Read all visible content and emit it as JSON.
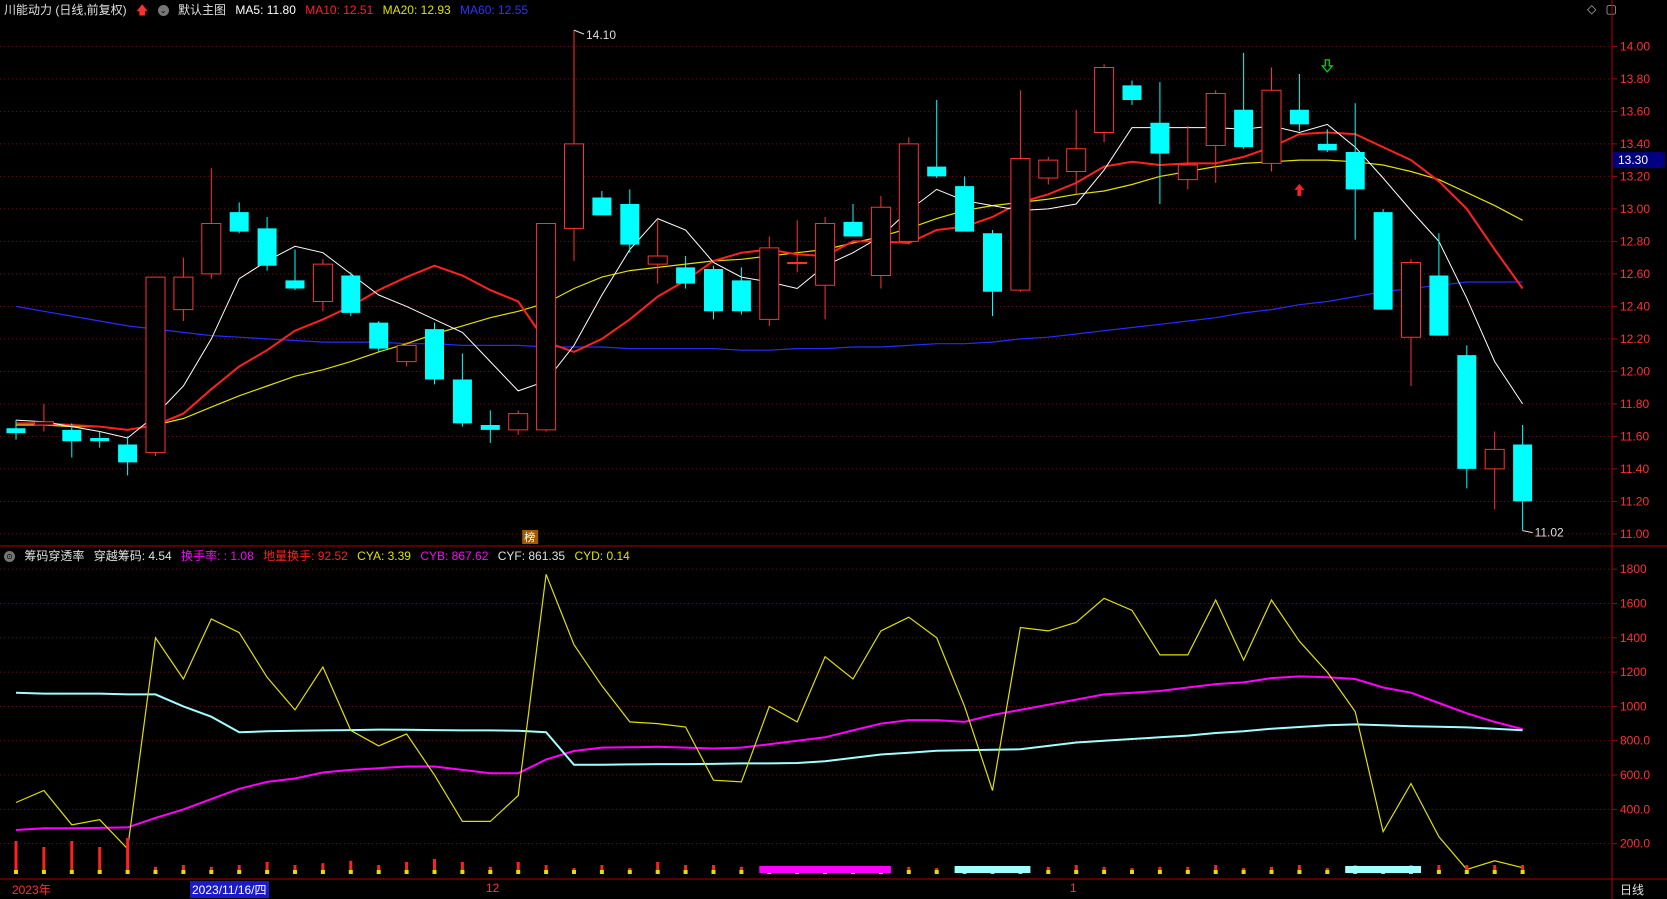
{
  "header": {
    "stock_name": "川能动力 (日线,前复权)",
    "main_view": "默认主图",
    "ma5": "MA5: 11.80",
    "ma10": "MA10: 12.51",
    "ma20": "MA20: 12.93",
    "ma60": "MA60: 12.55"
  },
  "sub_header": {
    "title": "筹码穿透率",
    "cross": "穿越筹码: 4.54",
    "turnover": "换手率: : 1.08",
    "ground": "地量换手: 92.52",
    "cya": "CYA: 3.39",
    "cyb": "CYB: 867.62",
    "cyf": "CYF: 861.35",
    "cyd": "CYD: 0.14"
  },
  "colors": {
    "up": "#ff3232",
    "down": "#00ffff",
    "ma5": "#ffffff",
    "ma10": "#ff2020",
    "ma20": "#e0e000",
    "ma60": "#2a2aff",
    "cyb": "#ff00ff",
    "cyf": "#a0ffff",
    "yellow_line": "#e0e000",
    "grid": "#8b0000",
    "price_tag_bg": "#000080"
  },
  "annotations": {
    "high_label": "14.10",
    "low_label": "11.02",
    "current_price": "13.30",
    "bang_label": "榜"
  },
  "dates": {
    "year": "2023年",
    "selected": "2023/11/16/四",
    "dec": "12",
    "jan": "1"
  },
  "period": "日线",
  "chart_data": {
    "type": "candlestick",
    "price_ylim": [
      10.95,
      14.15
    ],
    "price_ticks": [
      "14.00",
      "13.80",
      "13.60",
      "13.40",
      "13.20",
      "13.00",
      "12.80",
      "12.60",
      "12.40",
      "12.20",
      "12.00",
      "11.80",
      "11.60",
      "11.40",
      "11.20",
      "11.00"
    ],
    "candles": [
      [
        11.65,
        11.7,
        11.58,
        11.62
      ],
      [
        11.67,
        11.8,
        11.63,
        11.69
      ],
      [
        11.64,
        11.68,
        11.47,
        11.57
      ],
      [
        11.59,
        11.63,
        11.53,
        11.57
      ],
      [
        11.55,
        11.6,
        11.36,
        11.44
      ],
      [
        11.5,
        12.58,
        11.48,
        12.58
      ],
      [
        12.38,
        12.7,
        12.31,
        12.58
      ],
      [
        12.6,
        13.25,
        12.57,
        12.91
      ],
      [
        12.98,
        13.04,
        12.85,
        12.86
      ],
      [
        12.88,
        12.95,
        12.62,
        12.65
      ],
      [
        12.56,
        12.75,
        12.5,
        12.51
      ],
      [
        12.43,
        12.69,
        12.37,
        12.66
      ],
      [
        12.59,
        12.61,
        12.34,
        12.36
      ],
      [
        12.3,
        12.31,
        12.12,
        12.14
      ],
      [
        12.06,
        12.18,
        12.03,
        12.16
      ],
      [
        12.26,
        12.3,
        11.92,
        11.95
      ],
      [
        11.95,
        12.11,
        11.66,
        11.68
      ],
      [
        11.67,
        11.76,
        11.56,
        11.64
      ],
      [
        11.64,
        11.76,
        11.61,
        11.74
      ],
      [
        11.64,
        12.91,
        11.63,
        12.91
      ],
      [
        12.88,
        14.1,
        12.68,
        13.4
      ],
      [
        13.07,
        13.11,
        12.96,
        12.96
      ],
      [
        13.03,
        13.12,
        12.73,
        12.78
      ],
      [
        12.66,
        12.93,
        12.54,
        12.71
      ],
      [
        12.64,
        12.71,
        12.51,
        12.54
      ],
      [
        12.63,
        12.65,
        12.32,
        12.37
      ],
      [
        12.56,
        12.64,
        12.35,
        12.37
      ],
      [
        12.32,
        12.83,
        12.28,
        12.76
      ],
      [
        12.67,
        12.93,
        12.61,
        12.67
      ],
      [
        12.53,
        12.95,
        12.32,
        12.91
      ],
      [
        12.92,
        13.03,
        12.83,
        12.83
      ],
      [
        12.59,
        13.08,
        12.51,
        13.01
      ],
      [
        12.8,
        13.44,
        12.78,
        13.4
      ],
      [
        13.26,
        13.67,
        13.19,
        13.2
      ],
      [
        13.14,
        13.2,
        12.93,
        12.86
      ],
      [
        12.85,
        12.87,
        12.34,
        12.49
      ],
      [
        12.5,
        13.73,
        12.49,
        13.31
      ],
      [
        13.19,
        13.32,
        13.15,
        13.3
      ],
      [
        13.23,
        13.61,
        13.09,
        13.37
      ],
      [
        13.47,
        13.89,
        13.41,
        13.87
      ],
      [
        13.76,
        13.79,
        13.64,
        13.67
      ],
      [
        13.53,
        13.78,
        13.03,
        13.34
      ],
      [
        13.18,
        13.51,
        13.12,
        13.27
      ],
      [
        13.39,
        13.73,
        13.16,
        13.71
      ],
      [
        13.61,
        13.96,
        13.37,
        13.38
      ],
      [
        13.28,
        13.87,
        13.23,
        13.73
      ],
      [
        13.61,
        13.83,
        13.48,
        13.52
      ],
      [
        13.4,
        13.49,
        13.35,
        13.36
      ],
      [
        13.35,
        13.65,
        12.81,
        13.12
      ],
      [
        12.98,
        13.0,
        12.38,
        12.38
      ],
      [
        12.21,
        12.69,
        11.91,
        12.67
      ],
      [
        12.59,
        12.85,
        12.22,
        12.22
      ],
      [
        12.1,
        12.16,
        11.28,
        11.4
      ],
      [
        11.4,
        11.63,
        11.15,
        11.52
      ],
      [
        11.55,
        11.67,
        11.02,
        11.2
      ]
    ],
    "ma5": [
      11.7,
      11.69,
      11.66,
      11.63,
      11.59,
      11.73,
      11.91,
      12.2,
      12.57,
      12.68,
      12.77,
      12.73,
      12.6,
      12.47,
      12.4,
      12.32,
      12.24,
      12.06,
      11.88,
      11.94,
      12.16,
      12.47,
      12.75,
      12.94,
      12.87,
      12.67,
      12.58,
      12.55,
      12.51,
      12.65,
      12.73,
      12.83,
      12.99,
      13.12,
      13.05,
      13.02,
      12.99,
      13.0,
      13.03,
      13.24,
      13.5,
      13.5,
      13.5,
      13.5,
      13.49,
      13.51,
      13.47,
      13.52,
      13.38,
      13.19,
      12.99,
      12.8,
      12.45,
      12.06,
      11.8
    ],
    "ma10": [
      11.68,
      11.68,
      11.67,
      11.66,
      11.64,
      11.67,
      11.74,
      11.89,
      12.03,
      12.13,
      12.25,
      12.32,
      12.4,
      12.5,
      12.58,
      12.65,
      12.59,
      12.5,
      12.43,
      12.18,
      12.12,
      12.2,
      12.32,
      12.46,
      12.56,
      12.68,
      12.73,
      12.75,
      12.72,
      12.71,
      12.8,
      12.8,
      12.79,
      12.87,
      12.89,
      12.95,
      13.04,
      13.09,
      13.16,
      13.26,
      13.29,
      13.27,
      13.28,
      13.28,
      13.32,
      13.38,
      13.46,
      13.47,
      13.46,
      13.38,
      13.3,
      13.17,
      13.0,
      12.75,
      12.51
    ],
    "ma20": [
      11.67,
      11.67,
      11.66,
      11.66,
      11.64,
      11.67,
      11.71,
      11.78,
      11.85,
      11.91,
      11.97,
      12.01,
      12.06,
      12.12,
      12.17,
      12.23,
      12.28,
      12.33,
      12.37,
      12.42,
      12.51,
      12.58,
      12.62,
      12.64,
      12.66,
      12.68,
      12.69,
      12.71,
      12.73,
      12.75,
      12.79,
      12.83,
      12.88,
      12.94,
      12.99,
      13.02,
      13.04,
      13.06,
      13.09,
      13.11,
      13.15,
      13.2,
      13.23,
      13.26,
      13.28,
      13.29,
      13.3,
      13.3,
      13.29,
      13.27,
      13.23,
      13.18,
      13.1,
      13.02,
      12.93
    ],
    "ma60": [
      12.4,
      12.37,
      12.34,
      12.31,
      12.28,
      12.26,
      12.24,
      12.22,
      12.21,
      12.2,
      12.19,
      12.18,
      12.18,
      12.18,
      12.17,
      12.17,
      12.16,
      12.16,
      12.16,
      12.15,
      12.15,
      12.15,
      12.14,
      12.14,
      12.14,
      12.14,
      12.13,
      12.13,
      12.14,
      12.14,
      12.15,
      12.15,
      12.16,
      12.17,
      12.17,
      12.18,
      12.2,
      12.21,
      12.23,
      12.25,
      12.27,
      12.29,
      12.31,
      12.33,
      12.36,
      12.38,
      12.41,
      12.43,
      12.46,
      12.49,
      12.51,
      12.53,
      12.55,
      12.55,
      12.55
    ],
    "ind_ylim": [
      0,
      1900
    ],
    "ind_ticks": [
      "1800",
      "1600",
      "1400",
      "1200",
      "1000",
      "800.0",
      "600.0",
      "400.0",
      "200.0"
    ],
    "cya_yellow": [
      440,
      510,
      310,
      340,
      170,
      1400,
      1160,
      1510,
      1430,
      1170,
      980,
      1230,
      860,
      770,
      840,
      600,
      330,
      330,
      480,
      1770,
      1360,
      1120,
      910,
      900,
      880,
      570,
      560,
      1000,
      910,
      1290,
      1160,
      1440,
      1520,
      1400,
      1000,
      510,
      1460,
      1440,
      1490,
      1630,
      1560,
      1300,
      1300,
      1620,
      1270,
      1620,
      1380,
      1200,
      970,
      270,
      550,
      240,
      50,
      100,
      60
    ],
    "cyf_cyan": [
      1080,
      1075,
      1075,
      1075,
      1070,
      1070,
      1000,
      940,
      850,
      855,
      858,
      860,
      862,
      865,
      864,
      862,
      860,
      860,
      858,
      850,
      660,
      660,
      662,
      664,
      664,
      665,
      668,
      668,
      670,
      680,
      700,
      720,
      730,
      742,
      745,
      748,
      750,
      770,
      790,
      800,
      810,
      820,
      830,
      845,
      855,
      870,
      880,
      890,
      895,
      890,
      885,
      882,
      878,
      870,
      861
    ],
    "cyb_magenta": [
      280,
      290,
      290,
      292,
      295,
      350,
      400,
      460,
      520,
      560,
      580,
      615,
      630,
      640,
      650,
      650,
      630,
      610,
      610,
      690,
      740,
      760,
      762,
      765,
      760,
      755,
      760,
      780,
      800,
      820,
      860,
      900,
      920,
      920,
      910,
      950,
      980,
      1010,
      1040,
      1070,
      1080,
      1090,
      1110,
      1130,
      1140,
      1165,
      1175,
      1170,
      1160,
      1110,
      1080,
      1020,
      960,
      910,
      868
    ],
    "bottom_bars": [
      0.55,
      0.45,
      0.55,
      0.45,
      0.6,
      0.12,
      0.15,
      0.12,
      0.15,
      0.2,
      0.15,
      0.18,
      0.22,
      0.15,
      0.2,
      0.25,
      0.2,
      0.12,
      0.2,
      0.15,
      0.1,
      0.15,
      0.1,
      0.2,
      0.15,
      0.15,
      0.12,
      0.1,
      0.1,
      0.12,
      0.1,
      0.12,
      0.12,
      0.1,
      0.1,
      0.12,
      0.1,
      0.12,
      0.15,
      0.12,
      0.1,
      0.12,
      0.12,
      0.15,
      0.1,
      0.12,
      0.15,
      0.1,
      0.15,
      0.12,
      0.15,
      0.15,
      0.15,
      0.15,
      0.15
    ],
    "bottom_band_segments": [
      {
        "color": "#ff00ff",
        "from": 27,
        "to": 31
      },
      {
        "color": "#a0ffff",
        "from": 34,
        "to": 36
      },
      {
        "color": "#a0ffff",
        "from": 48,
        "to": 50
      }
    ]
  }
}
